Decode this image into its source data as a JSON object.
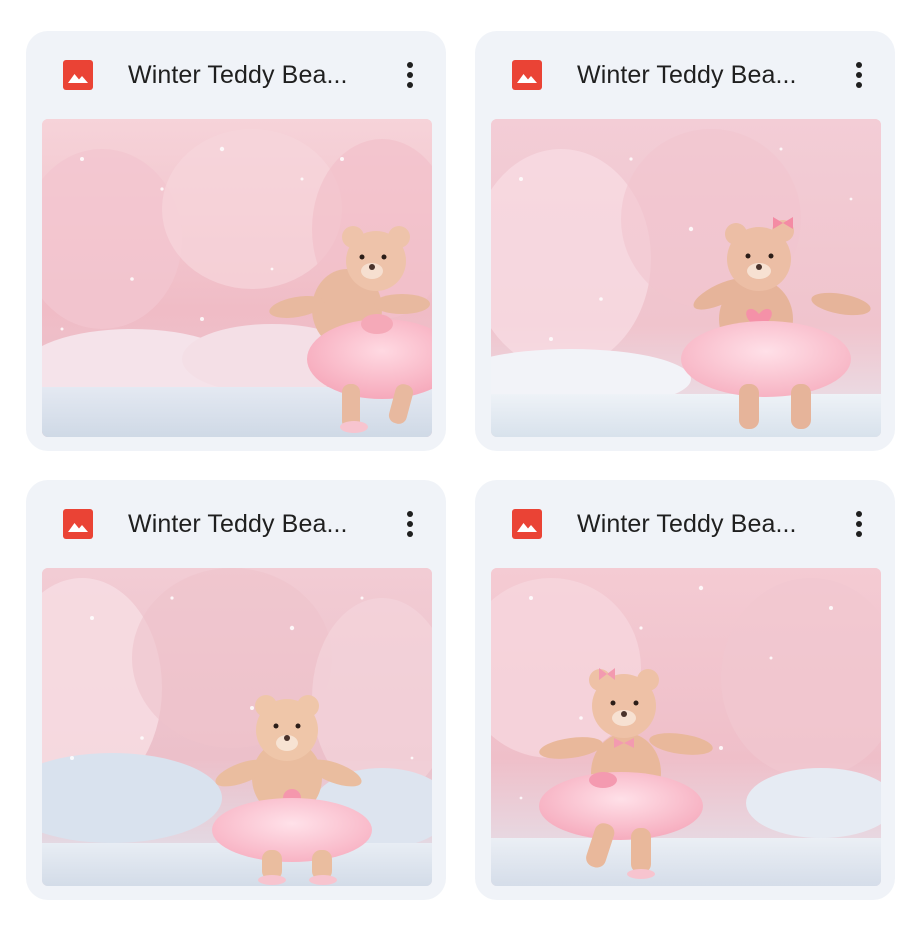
{
  "cards": [
    {
      "title": "Winter Teddy Bea...",
      "file_type_icon": "image-file-icon",
      "menu_icon": "more-vert-icon",
      "thumbnail": "teddy bear in pink tutu skating in snowy pink forest"
    },
    {
      "title": "Winter Teddy Bea...",
      "file_type_icon": "image-file-icon",
      "menu_icon": "more-vert-icon",
      "thumbnail": "teddy bear with pink bow and heart skating on frozen lake"
    },
    {
      "title": "Winter Teddy Bea...",
      "file_type_icon": "image-file-icon",
      "menu_icon": "more-vert-icon",
      "thumbnail": "teddy bear in pink tutu standing on ice in snowy forest"
    },
    {
      "title": "Winter Teddy Bea...",
      "file_type_icon": "image-file-icon",
      "menu_icon": "more-vert-icon",
      "thumbnail": "teddy bear with bow skating with arms spread in pink forest"
    }
  ],
  "colors": {
    "card_background": "#f0f3f8",
    "image_icon_red": "#ea4335",
    "title_text": "#1f1f1f"
  }
}
